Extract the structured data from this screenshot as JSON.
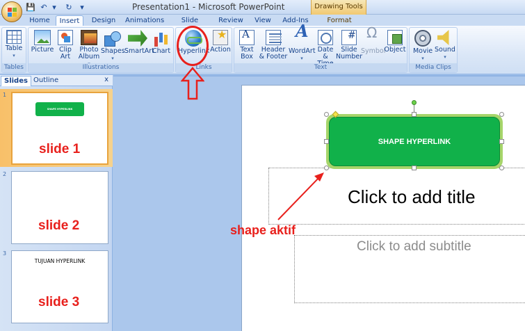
{
  "window": {
    "title": "Presentation1 - Microsoft PowerPoint",
    "context_tool": "Drawing Tools"
  },
  "qat": {
    "save": "💾",
    "undo": "↶",
    "undo_drop": "▾",
    "redo": "↻",
    "customize": "▾"
  },
  "tabs": {
    "home": "Home",
    "insert": "Insert",
    "design": "Design",
    "animations": "Animations",
    "slideshow": "Slide Show",
    "review": "Review",
    "view": "View",
    "addins": "Add-Ins",
    "format": "Format",
    "active": "Insert"
  },
  "ribbon": {
    "tables": {
      "label": "Tables",
      "table": "Table"
    },
    "illustrations": {
      "label": "Illustrations",
      "picture": "Picture",
      "clipart_1": "Clip",
      "clipart_2": "Art",
      "photo_1": "Photo",
      "photo_2": "Album",
      "shapes": "Shapes",
      "smartart": "SmartArt",
      "chart": "Chart"
    },
    "links": {
      "label": "Links",
      "hyperlink": "Hyperlink",
      "action": "Action"
    },
    "text": {
      "label": "Text",
      "textbox_1": "Text",
      "textbox_2": "Box",
      "header_1": "Header",
      "header_2": "& Footer",
      "wordart": "WordArt",
      "date_1": "Date",
      "date_2": "& Time",
      "slidenum_1": "Slide",
      "slidenum_2": "Number",
      "symbol": "Symbol",
      "object": "Object"
    },
    "media": {
      "label": "Media Clips",
      "movie": "Movie",
      "sound": "Sound"
    },
    "dropdown_glyph": "▾"
  },
  "panel": {
    "tab_slides": "Slides",
    "tab_outline": "Outline",
    "close": "x",
    "slides": [
      {
        "num": "1",
        "shape_text": "SHAPE HYPERLINK",
        "title": "",
        "label": "slide 1"
      },
      {
        "num": "2",
        "shape_text": "",
        "title": "",
        "label": "slide 2"
      },
      {
        "num": "3",
        "shape_text": "",
        "title": "TUJUAN HYPERLINK",
        "label": "slide 3"
      }
    ]
  },
  "slide": {
    "shape_text": "SHAPE HYPERLINK",
    "title_placeholder": "Click to add title",
    "subtitle_placeholder": "Click to add subtitle"
  },
  "annotations": {
    "shape_active": "shape aktif",
    "color": "#e8201c"
  },
  "colors": {
    "shape_fill": "#11b14a",
    "shape_glow": "#a6d56a",
    "ribbon_text": "#15428b",
    "selected_thumb": "#f8c069"
  }
}
